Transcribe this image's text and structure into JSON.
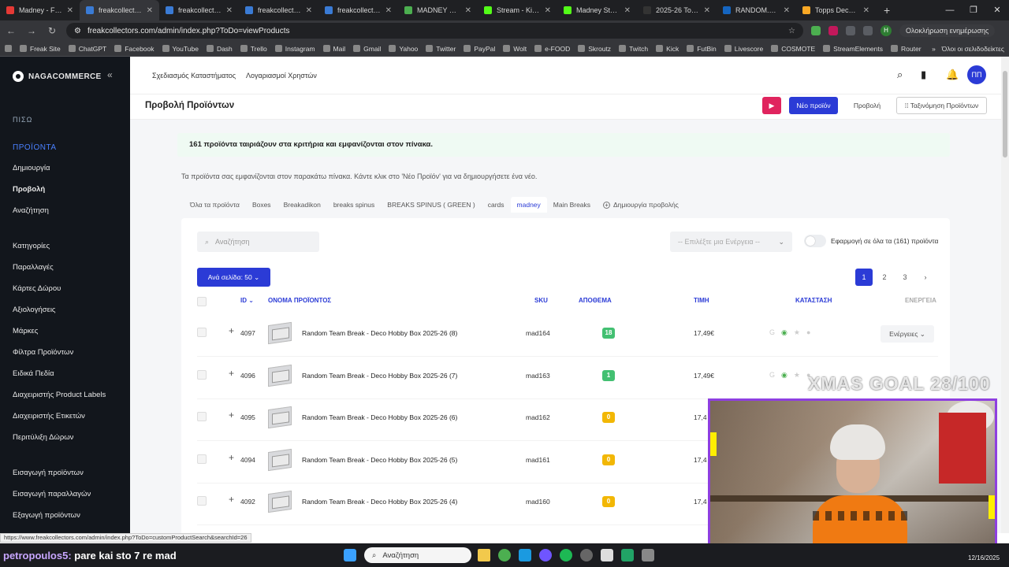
{
  "browser": {
    "tabs": [
      {
        "title": "Madney - Freak C",
        "color": "#e53935"
      },
      {
        "title": "freakcollectors.co",
        "color": "#3a7bd5"
      },
      {
        "title": "freakcollectors.co",
        "color": "#3a7bd5"
      },
      {
        "title": "freakcollectors.co",
        "color": "#3a7bd5"
      },
      {
        "title": "freakcollectors.co",
        "color": "#3a7bd5"
      },
      {
        "title": "MADNEY BREAKS",
        "color": "#4caf50"
      },
      {
        "title": "Stream - Kick Da",
        "color": "#53fc18"
      },
      {
        "title": "Madney Stream",
        "color": "#53fc18"
      },
      {
        "title": "2025-26 Topps D",
        "color": "#333"
      },
      {
        "title": "RANDOM.ORG",
        "color": "#1565c0"
      },
      {
        "title": "Topps Deco 25/2",
        "color": "#f9a825"
      }
    ],
    "url": "freakcollectors.com/admin/index.php?ToDo=viewProducts",
    "complete_label": "Ολοκλήρωση ενημέρωσης",
    "profile_initial": "H",
    "bookmarks": [
      "Freak Site",
      "ChatGPT",
      "Facebook",
      "YouTube",
      "Dash",
      "Trello",
      "Instagram",
      "Mail",
      "Gmail",
      "Yahoo",
      "Twitter",
      "PayPal",
      "Wolt",
      "e-FOOD",
      "Skroutz",
      "Twitch",
      "Kick",
      "FutBin",
      "Livescore",
      "COSMOTE",
      "StreamElements",
      "Router"
    ],
    "all_bookmarks": "Όλοι οι σελιδοδείκτες"
  },
  "sidebar": {
    "brand": "NAGACOMMERCE",
    "back": "ΠΙΣΩ",
    "section": "ΠΡΟΪΟΝΤΑ",
    "items": [
      "Δημιουργία",
      "Προβολή",
      "Αναζήτηση",
      "Κατηγορίες",
      "Παραλλαγές",
      "Κάρτες Δώρου",
      "Αξιολογήσεις",
      "Μάρκες",
      "Φίλτρα Προϊόντων",
      "Ειδικά Πεδία",
      "Διαχειριστής Product Labels",
      "Διαχειριστής Ετικετών",
      "Περιτύλιξη Δώρων",
      "Εισαγωγή προϊόντων",
      "Εισαγωγή παραλλαγών",
      "Εξαγωγή προϊόντων"
    ]
  },
  "topnav": {
    "links": [
      "Σχεδιασμός Καταστήματος",
      "Λογαριασμοί Χρηστών"
    ],
    "user_initials": "ΠΠ"
  },
  "page": {
    "title": "Προβολή Προϊόντων",
    "new_product": "Νέο προϊόν",
    "view": "Προβολή",
    "sort": "Ταξινόμηση Προϊόντων"
  },
  "content": {
    "alert": "161 προϊόντα ταιριάζουν στα κριτήρια και εμφανίζονται στον πίνακα.",
    "info": "Τα προϊόντα σας εμφανίζονται στον παρακάτω πίνακα. Κάντε κλικ στο 'Νέο Προϊόν' για να δημιουργήσετε ένα νέο.",
    "view_tabs": [
      "Όλα τα προϊόντα",
      "Boxes",
      "Breakadikon",
      "breaks spinus",
      "BREAKS SPINUS ( GREEN )",
      "cards",
      "madney",
      "Main Breaks"
    ],
    "active_tab": "madney",
    "create_view": "Δημιουργία προβολής",
    "search_placeholder": "Αναζήτηση",
    "action_select": "-- Επιλέξτε μια Ενέργεια --",
    "apply_all": "Εφαρμογή σε όλα τα (161) προϊόντα",
    "per_page": "Ανά σελίδα: 50",
    "pages": [
      "1",
      "2",
      "3"
    ],
    "current_page": "1"
  },
  "table": {
    "headers": {
      "id": "ID",
      "name": "ΟΝΟΜΑ ΠΡΟΪΟΝΤΟΣ",
      "sku": "SKU",
      "stock": "ΑΠΟΘΕΜΑ",
      "price": "ΤΙΜΗ",
      "status": "ΚΑΤΑΣΤΑΣΗ",
      "actions": "ΕΝΕΡΓΕΙΑ"
    },
    "action_label": "Ενέργειες",
    "rows": [
      {
        "id": "4097",
        "name": "Random Team Break - Deco Hobby Box 2025-26 (8)",
        "sku": "mad164",
        "stock": "18",
        "stock_color": "#43c072",
        "price": "17,49€"
      },
      {
        "id": "4096",
        "name": "Random Team Break - Deco Hobby Box 2025-26 (7)",
        "sku": "mad163",
        "stock": "1",
        "stock_color": "#43c072",
        "price": "17,49€"
      },
      {
        "id": "4095",
        "name": "Random Team Break - Deco Hobby Box 2025-26 (6)",
        "sku": "mad162",
        "stock": "0",
        "stock_color": "#f2b705",
        "price": "17,4"
      },
      {
        "id": "4094",
        "name": "Random Team Break - Deco Hobby Box 2025-26 (5)",
        "sku": "mad161",
        "stock": "0",
        "stock_color": "#f2b705",
        "price": "17,4"
      },
      {
        "id": "4092",
        "name": "Random Team Break - Deco Hobby Box 2025-26 (4)",
        "sku": "mad160",
        "stock": "0",
        "stock_color": "#f2b705",
        "price": "17,4"
      }
    ]
  },
  "overlay": {
    "goal": "XMAS GOAL 28/100",
    "chat_user": "petropoulos5:",
    "chat_message": "pare kai sto 7 re mad"
  },
  "status_url": "https://www.freakcollectors.com/admin/index.php?ToDo=customProductSearch&searchId=26",
  "taskbar": {
    "search": "Αναζήτηση",
    "date": "12/16/2025"
  }
}
